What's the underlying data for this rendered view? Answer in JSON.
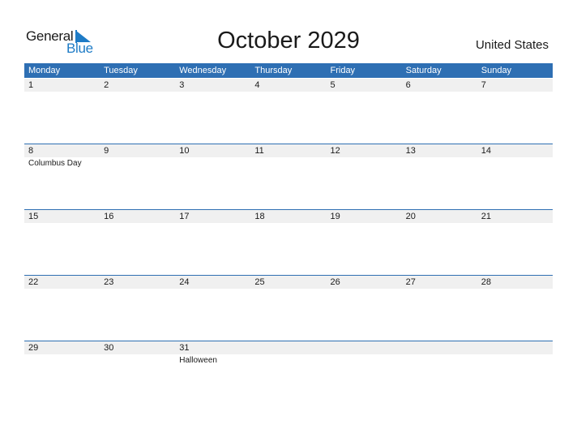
{
  "logo": {
    "word1": "General",
    "word2": "Blue"
  },
  "title": "October 2029",
  "country": "United States",
  "colors": {
    "accent": "#2e6fb3",
    "row_bg": "#f0f0f0",
    "logo_blue": "#1e7bc6"
  },
  "days": [
    "Monday",
    "Tuesday",
    "Wednesday",
    "Thursday",
    "Friday",
    "Saturday",
    "Sunday"
  ],
  "weeks": [
    {
      "cells": [
        {
          "num": "1",
          "holiday": ""
        },
        {
          "num": "2",
          "holiday": ""
        },
        {
          "num": "3",
          "holiday": ""
        },
        {
          "num": "4",
          "holiday": ""
        },
        {
          "num": "5",
          "holiday": ""
        },
        {
          "num": "6",
          "holiday": ""
        },
        {
          "num": "7",
          "holiday": ""
        }
      ]
    },
    {
      "cells": [
        {
          "num": "8",
          "holiday": "Columbus Day"
        },
        {
          "num": "9",
          "holiday": ""
        },
        {
          "num": "10",
          "holiday": ""
        },
        {
          "num": "11",
          "holiday": ""
        },
        {
          "num": "12",
          "holiday": ""
        },
        {
          "num": "13",
          "holiday": ""
        },
        {
          "num": "14",
          "holiday": ""
        }
      ]
    },
    {
      "cells": [
        {
          "num": "15",
          "holiday": ""
        },
        {
          "num": "16",
          "holiday": ""
        },
        {
          "num": "17",
          "holiday": ""
        },
        {
          "num": "18",
          "holiday": ""
        },
        {
          "num": "19",
          "holiday": ""
        },
        {
          "num": "20",
          "holiday": ""
        },
        {
          "num": "21",
          "holiday": ""
        }
      ]
    },
    {
      "cells": [
        {
          "num": "22",
          "holiday": ""
        },
        {
          "num": "23",
          "holiday": ""
        },
        {
          "num": "24",
          "holiday": ""
        },
        {
          "num": "25",
          "holiday": ""
        },
        {
          "num": "26",
          "holiday": ""
        },
        {
          "num": "27",
          "holiday": ""
        },
        {
          "num": "28",
          "holiday": ""
        }
      ]
    },
    {
      "cells": [
        {
          "num": "29",
          "holiday": ""
        },
        {
          "num": "30",
          "holiday": ""
        },
        {
          "num": "31",
          "holiday": "Halloween"
        },
        {
          "num": "",
          "holiday": ""
        },
        {
          "num": "",
          "holiday": ""
        },
        {
          "num": "",
          "holiday": ""
        },
        {
          "num": "",
          "holiday": ""
        }
      ]
    }
  ]
}
